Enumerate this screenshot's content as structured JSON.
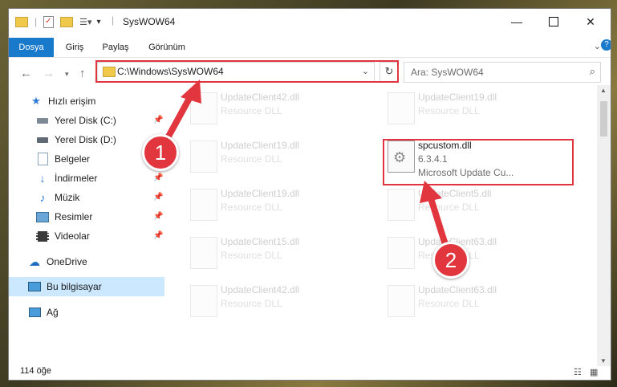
{
  "window": {
    "title": "SysWOW64"
  },
  "ribbon": {
    "tabs": [
      "Dosya",
      "Giriş",
      "Paylaş",
      "Görünüm"
    ]
  },
  "address": {
    "path": "C:\\Windows\\SysWOW64"
  },
  "search": {
    "placeholder": "Ara: SysWOW64"
  },
  "sidebar": {
    "items": [
      {
        "label": "Hızlı erişim",
        "icon": "star-icon"
      },
      {
        "label": "Yerel Disk (C:)",
        "icon": "drive-icon"
      },
      {
        "label": "Yerel Disk (D:)",
        "icon": "drive-icon"
      },
      {
        "label": "Belgeler",
        "icon": "documents-icon"
      },
      {
        "label": "İndirmeler",
        "icon": "downloads-icon"
      },
      {
        "label": "Müzik",
        "icon": "music-icon"
      },
      {
        "label": "Resimler",
        "icon": "pictures-icon"
      },
      {
        "label": "Videolar",
        "icon": "videos-icon"
      },
      {
        "label": "OneDrive",
        "icon": "cloud-icon"
      },
      {
        "label": "Bu bilgisayar",
        "icon": "computer-icon"
      },
      {
        "label": "Ağ",
        "icon": "network-icon"
      }
    ]
  },
  "files": {
    "left": [
      {
        "name": "UpdateClient42.dll",
        "type": "Resource DLL"
      },
      {
        "name": "UpdateClient19.dll",
        "type": "Resource DLL"
      },
      {
        "name": "UpdateClient19.dll",
        "type": "Resource DLL"
      },
      {
        "name": "UpdateClient15.dll",
        "type": "Resource DLL"
      },
      {
        "name": "UpdateClient42.dll",
        "type": "Resource DLL"
      }
    ],
    "right": [
      {
        "name": "UpdateClient19.dll",
        "type": "Resource DLL"
      },
      {
        "name": "UpdateClient5.dll",
        "type": "Resource DLL"
      },
      {
        "name": "UpdateClient63.dll",
        "type": "Resource DLL"
      },
      {
        "name": "UpdateClient63.dll",
        "type": "Resource DLL"
      }
    ],
    "highlighted": {
      "name": "spcustom.dll",
      "version": "6.3.4.1",
      "description": "Microsoft Update Cu..."
    }
  },
  "status": {
    "count": "114 öğe"
  },
  "annotations": {
    "badge1": "1",
    "badge2": "2",
    "color": "#e2363f"
  }
}
